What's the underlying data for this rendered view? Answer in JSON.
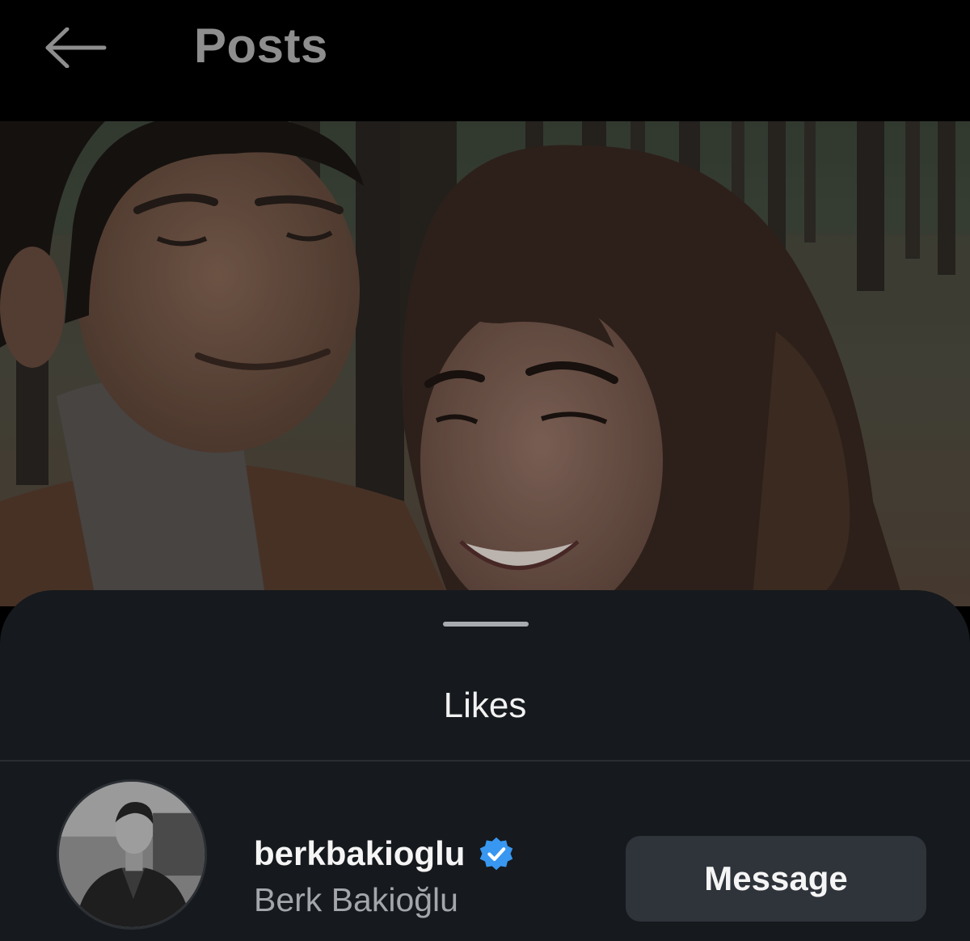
{
  "header": {
    "back_icon": "arrow-left-icon",
    "title": "Posts"
  },
  "post": {
    "image_description_icon": "photo"
  },
  "likes_sheet": {
    "title": "Likes",
    "users": [
      {
        "username": "berkbakioglu",
        "full_name": "Berk Bakioğlu",
        "verified": true,
        "verified_icon": "verified-badge-icon",
        "verified_color": "#3897f0",
        "action_label": "Message"
      }
    ]
  },
  "colors": {
    "background": "#000000",
    "sheet": "#16191d",
    "button": "#2f333a",
    "header_title": "#8e8e8e"
  }
}
